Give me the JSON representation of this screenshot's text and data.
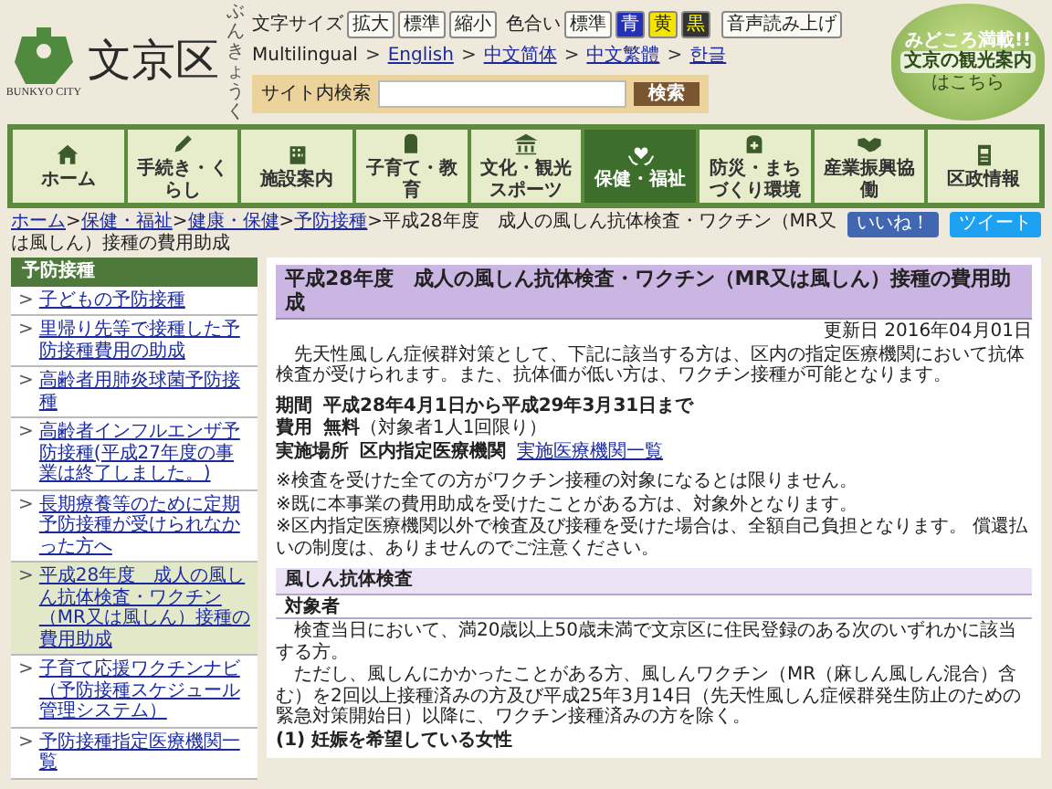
{
  "header": {
    "logo_text": "文京区",
    "logo_reading": "ぶんきょうく",
    "logo_caption": "BUNKYO CITY",
    "font_size": {
      "label": "文字サイズ",
      "buttons": [
        "拡大",
        "標準",
        "縮小"
      ]
    },
    "color_scheme": {
      "label": "色合い",
      "options": [
        {
          "label": "標準",
          "kind": "standard"
        },
        {
          "label": "青",
          "kind": "blue"
        },
        {
          "label": "黄",
          "kind": "yellow"
        },
        {
          "label": "黒",
          "kind": "black"
        }
      ]
    },
    "read_aloud": "音声読み上げ",
    "multilingual": {
      "label": "Multilingual",
      "separator": ">",
      "links": [
        "English",
        "中文简体",
        "中文繁體",
        "한글"
      ]
    },
    "search": {
      "label": "サイト内検索",
      "button": "検索"
    },
    "tourism_banner": {
      "tagline": "みどころ満載!!",
      "title": "文京の観光案内",
      "subtitle": "はこちら"
    }
  },
  "nav": {
    "items": [
      {
        "label": "ホーム",
        "selected": false
      },
      {
        "label": "手続き・くらし",
        "selected": false
      },
      {
        "label": "施設案内",
        "selected": false
      },
      {
        "label": "子育て・教育",
        "selected": false
      },
      {
        "label": "文化・観光スポーツ",
        "selected": false
      },
      {
        "label": "保健・福祉",
        "selected": true
      },
      {
        "label": "防災・まちづくり環境",
        "selected": false
      },
      {
        "label": "産業振興協働",
        "selected": false
      },
      {
        "label": "区政情報",
        "selected": false
      }
    ]
  },
  "breadcrumb": {
    "separator": ">",
    "links": [
      "ホーム",
      "保健・福祉",
      "健康・保健",
      "予防接種"
    ],
    "current": "平成28年度　成人の風しん抗体検査・ワクチン（MR又は風しん）接種の費用助成"
  },
  "social": {
    "like": "いいね！",
    "tweet": "ツイート"
  },
  "sidebar": {
    "title": "予防接種",
    "marker": ">",
    "items": [
      {
        "label": "子どもの予防接種",
        "selected": false
      },
      {
        "label": "里帰り先等で接種した予防接種費用の助成",
        "selected": false
      },
      {
        "label": "高齢者用肺炎球菌予防接種",
        "selected": false
      },
      {
        "label": "高齢者インフルエンザ予防接種(平成27年度の事業は終了しました。)",
        "selected": false
      },
      {
        "label": "長期療養等のために定期予防接種が受けられなかった方へ",
        "selected": false
      },
      {
        "label": "平成28年度　成人の風しん抗体検査・ワクチン（MR又は風しん）接種の費用助成",
        "selected": true
      },
      {
        "label": "子育て応援ワクチンナビ（予防接種スケジュール管理システム）",
        "selected": false
      },
      {
        "label": "予防接種指定医療機関一覧",
        "selected": false
      }
    ]
  },
  "main": {
    "title": "平成28年度　成人の風しん抗体検査・ワクチン（MR又は風しん）接種の費用助成",
    "updated": "更新日 2016年04月01日",
    "intro": "先天性風しん症候群対策として、下記に該当する方は、区内の指定医療機関において抗体検査が受けられます。また、抗体価が低い方は、ワクチン接種が可能となります。",
    "details": [
      {
        "term": "期間",
        "value": "平成28年4月1日から平成29年3月31日まで",
        "bold": true
      },
      {
        "term": "費用",
        "value": "**無料**（対象者1人1回限り）",
        "bold": false
      },
      {
        "term": "実施場所",
        "value": "区内指定医療機関",
        "bold": true,
        "link": "実施医療機関一覧"
      }
    ],
    "notes": [
      "※検査を受けた全ての方がワクチン接種の対象になるとは限りません。",
      "※既に本事業の費用助成を受けたことがある方は、対象外となります。",
      "※区内指定医療機関以外で検査及び接種を受けた場合は、全額自己負担となります。 償還払いの制度は、ありませんのでご注意ください。"
    ],
    "section": {
      "heading": "風しん抗体検査",
      "subheading": "対象者",
      "paragraphs": [
        "検査当日において、満20歳以上50歳未満で文京区に住民登録のある次のいずれかに該当する方。",
        "ただし、風しんにかかったことがある方、風しんワクチン（MR（麻しん風しん混合）含む）を2回以上接種済みの方及び平成25年3月14日（先天性風しん症候群発生防止のための緊急対策開始日）以降に、ワクチン接種済みの方を除く。"
      ],
      "list_item": "(1) 妊娠を希望している女性"
    }
  }
}
